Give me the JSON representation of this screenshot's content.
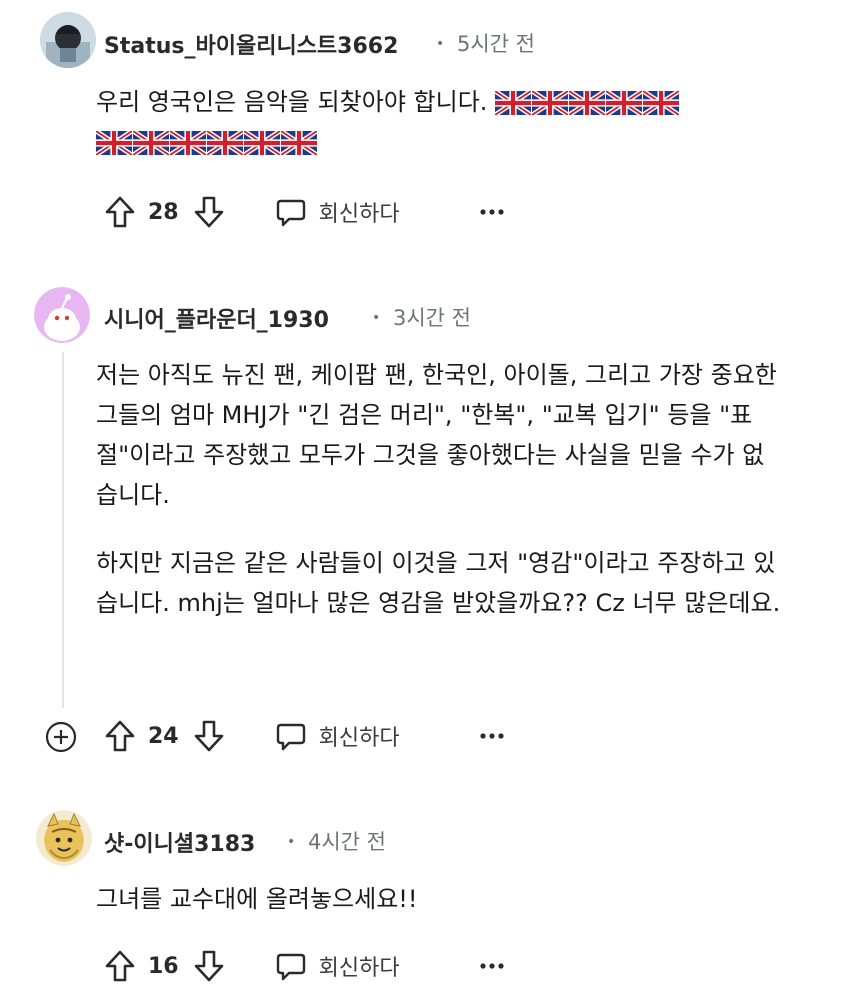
{
  "comments": [
    {
      "author": "Status_바이올리니스트3662",
      "time": "5시간 전",
      "text": "우리 영국인은 음악을 되찾아야 합니다.",
      "flag_count_line1": 5,
      "flag_count_line2": 6,
      "score": "28",
      "reply_label": "회신하다"
    },
    {
      "author": "시니어_플라운더_1930",
      "time": "3시간 전",
      "paragraph1": "저는 아직도 뉴진 팬, 케이팝 팬, 한국인, 아이돌, 그리고 가장 중요한 그들의 엄마 MHJ가 \"긴 검은 머리\", \"한복\", \"교복 입기\" 등을 \"표절\"이라고 주장했고 모두가 그것을 좋아했다는 사실을 믿을 수가 없습니다.",
      "paragraph2": "하지만 지금은 같은 사람들이 이것을 그저 \"영감\"이라고 주장하고 있습니다. mhj는 얼마나 많은 영감을 받았을까요?? Cz 너무 많은데요.",
      "score": "24",
      "reply_label": "회신하다"
    },
    {
      "author": "샷-이니셜3183",
      "time": "4시간 전",
      "text": "그녀를 교수대에 올려놓으세요!!",
      "score": "16",
      "reply_label": "회신하다"
    }
  ],
  "icons": {
    "upvote": "arrow-up-icon",
    "downvote": "arrow-down-icon",
    "reply": "speech-bubble-icon",
    "more": "ellipsis-icon",
    "expand": "plus-circle-icon",
    "flag": "union-jack-flag"
  },
  "colors": {
    "meta": "#6f7378",
    "thread_line": "#e3e5e8",
    "avatar2_bg": "#e8b6f0"
  }
}
